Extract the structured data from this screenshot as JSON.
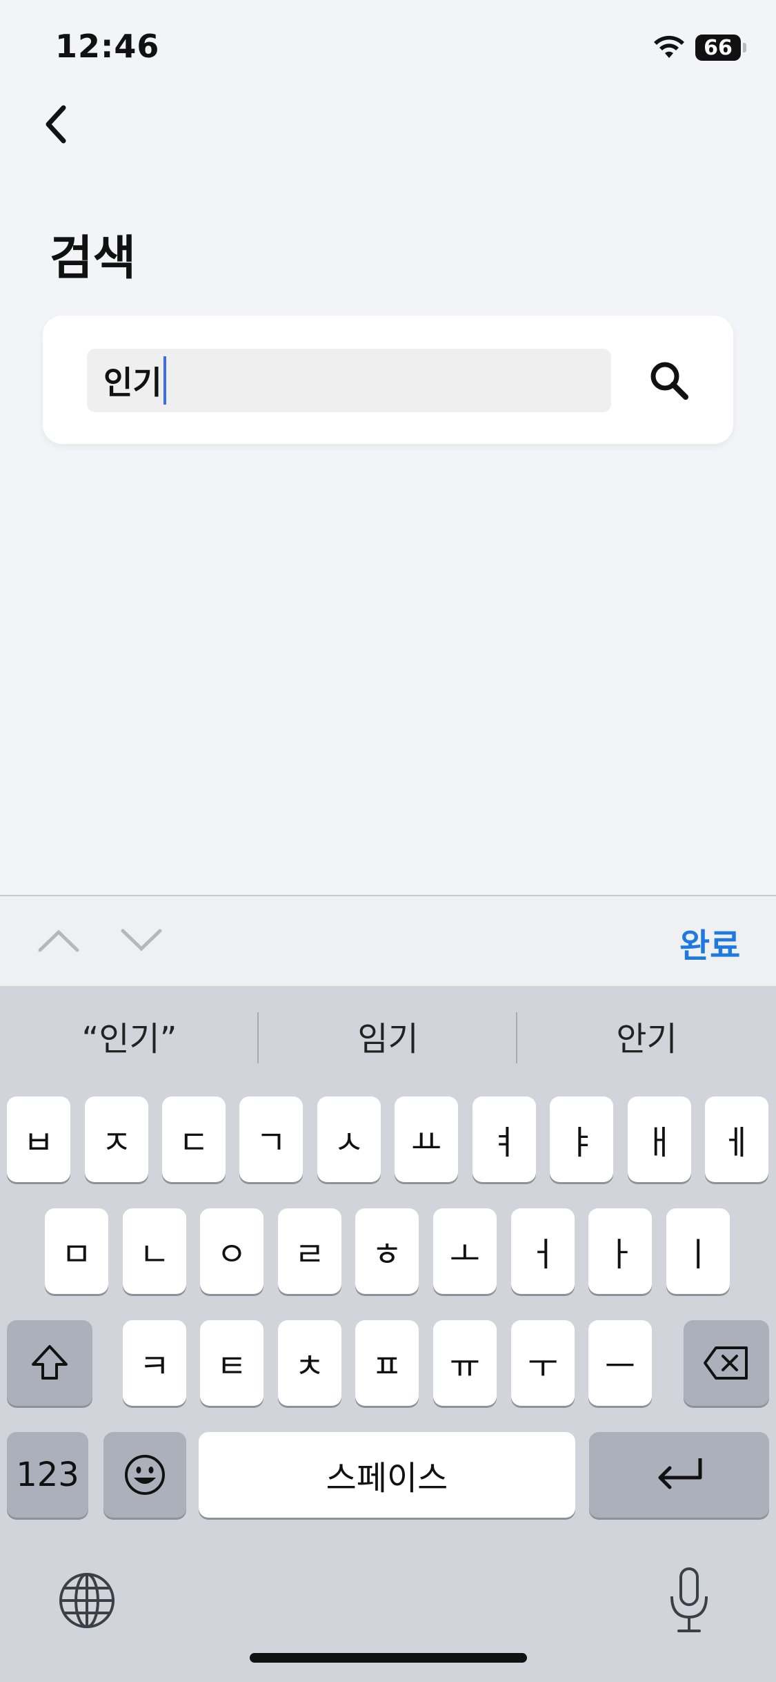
{
  "status_bar": {
    "time": "12:46",
    "battery": "66"
  },
  "header": {
    "title": "검색"
  },
  "search": {
    "value": "인기",
    "placeholder": ""
  },
  "accessory": {
    "done_label": "완료"
  },
  "suggestions": [
    "“인기”",
    "임기",
    "안기"
  ],
  "keyboard": {
    "row1": [
      "ㅂ",
      "ㅈ",
      "ㄷ",
      "ㄱ",
      "ㅅ",
      "ㅛ",
      "ㅕ",
      "ㅑ",
      "ㅐ",
      "ㅔ"
    ],
    "row2": [
      "ㅁ",
      "ㄴ",
      "ㅇ",
      "ㄹ",
      "ㅎ",
      "ㅗ",
      "ㅓ",
      "ㅏ",
      "ㅣ"
    ],
    "row3": [
      "ㅋ",
      "ㅌ",
      "ㅊ",
      "ㅍ",
      "ㅠ",
      "ㅜ",
      "ㅡ"
    ],
    "numbers_label": "123",
    "space_label": "스페이스"
  },
  "icons": {
    "back": "chevron-left-icon",
    "search": "magnifier-icon",
    "shift": "shift-icon",
    "delete": "backspace-icon",
    "emoji": "emoji-icon",
    "return": "return-icon",
    "globe": "globe-icon",
    "mic": "microphone-icon"
  }
}
